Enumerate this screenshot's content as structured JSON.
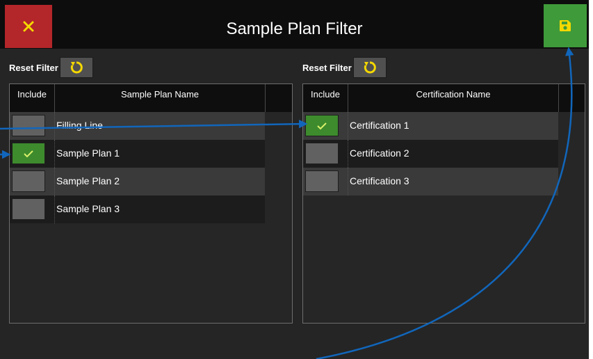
{
  "window": {
    "title": "Sample Plan Filter",
    "close_icon": "close-x-icon",
    "save_icon": "floppy-disk-save-icon"
  },
  "colors": {
    "close_bg": "#b3262a",
    "close_icon": "#f5d800",
    "save_bg": "#3f9a3a",
    "save_icon": "#f5d800",
    "checked_bg": "#3d8b2d",
    "checkmark": "#d8f06a",
    "reset_icon": "#f5d800",
    "annotation": "#1166bb"
  },
  "left_panel": {
    "reset_label": "Reset Filter",
    "reset_icon": "rotate-reset-icon",
    "headers": {
      "include": "Include",
      "name": "Sample Plan Name"
    },
    "rows": [
      {
        "label": "Filling Line",
        "checked": false
      },
      {
        "label": "Sample Plan 1",
        "checked": true
      },
      {
        "label": "Sample Plan 2",
        "checked": false
      },
      {
        "label": "Sample Plan 3",
        "checked": false
      }
    ]
  },
  "right_panel": {
    "reset_label": "Reset Filter",
    "reset_icon": "rotate-reset-icon",
    "headers": {
      "include": "Include",
      "name": "Certification Name"
    },
    "rows": [
      {
        "label": "Certification 1",
        "checked": true
      },
      {
        "label": "Certification 2",
        "checked": false
      },
      {
        "label": "Certification 3",
        "checked": false
      }
    ]
  }
}
